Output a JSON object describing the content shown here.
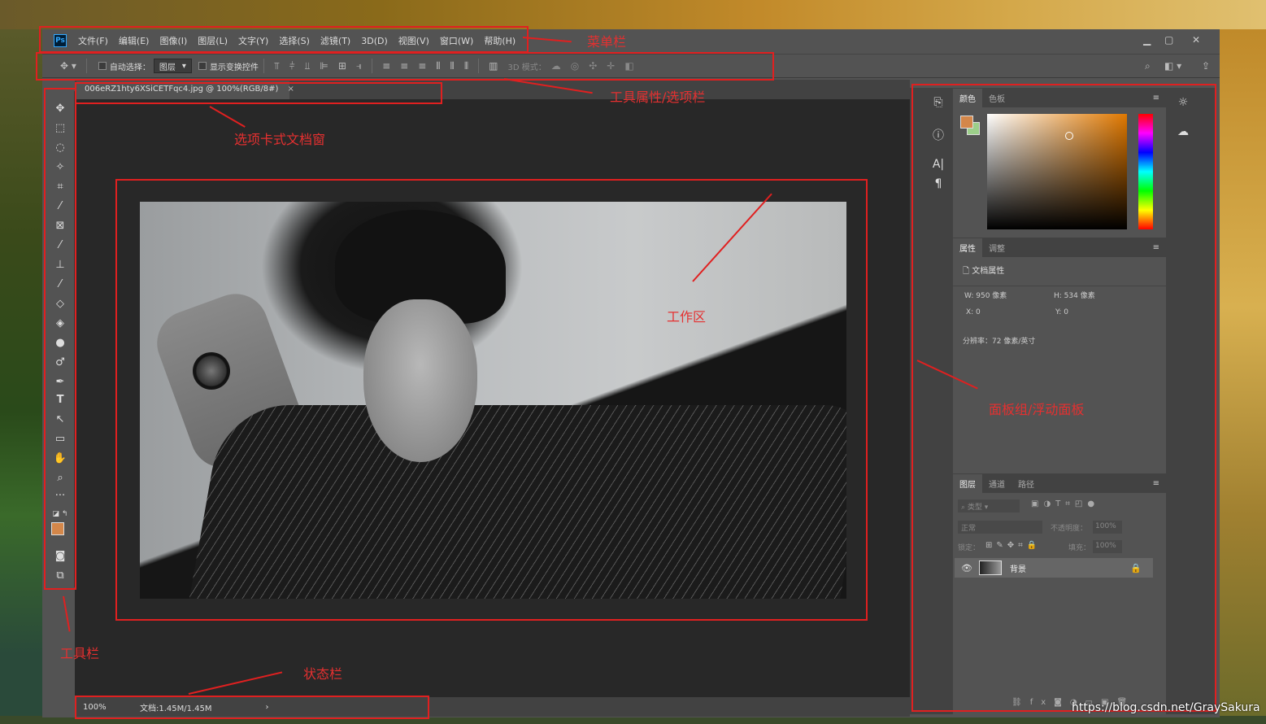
{
  "app": {
    "logo": "Ps",
    "menus": [
      "文件(F)",
      "编辑(E)",
      "图像(I)",
      "图层(L)",
      "文字(Y)",
      "选择(S)",
      "滤镜(T)",
      "3D(D)",
      "视图(V)",
      "窗口(W)",
      "帮助(H)"
    ]
  },
  "options": {
    "auto_select_label": "自动选择：",
    "layer_select": "图层",
    "show_transform": "显示变换控件",
    "mode3d": "3D 模式："
  },
  "document": {
    "tab_title": "006eRZ1hty6XSiCETFqc4.jpg @ 100%(RGB/8#)",
    "tab_close": "×"
  },
  "status": {
    "zoom": "100%",
    "doc_info": "文档:1.45M/1.45M",
    "arrow": "›"
  },
  "panels": {
    "color_tabs": [
      "颜色",
      "色板"
    ],
    "prop_tabs": [
      "属性",
      "调整"
    ],
    "doc_props": "文档属性",
    "w": "W:  950 像素",
    "h": "H:  534 像素",
    "x": "X:  0",
    "y": "Y:  0",
    "resolution": "分辨率：72 像素/英寸",
    "layer_tabs": [
      "图层",
      "通道",
      "路径"
    ],
    "layer_kind": "类型",
    "blend": "正常",
    "opacity_label": "不透明度：",
    "opacity": "100%",
    "lock_label": "锁定：",
    "fill_label": "填充：",
    "fill": "100%",
    "layer_name": "背景"
  },
  "colors": {
    "foreground": "#d4874a",
    "background": "#9ccf8a",
    "annotation": "#e02020"
  },
  "annotations": [
    "菜单栏",
    "工具属性/选项栏",
    "选项卡式文档窗",
    "工作区",
    "面板组/浮动面板",
    "工具栏",
    "状态栏"
  ],
  "watermark": "https://blog.csdn.net/GraySakura"
}
